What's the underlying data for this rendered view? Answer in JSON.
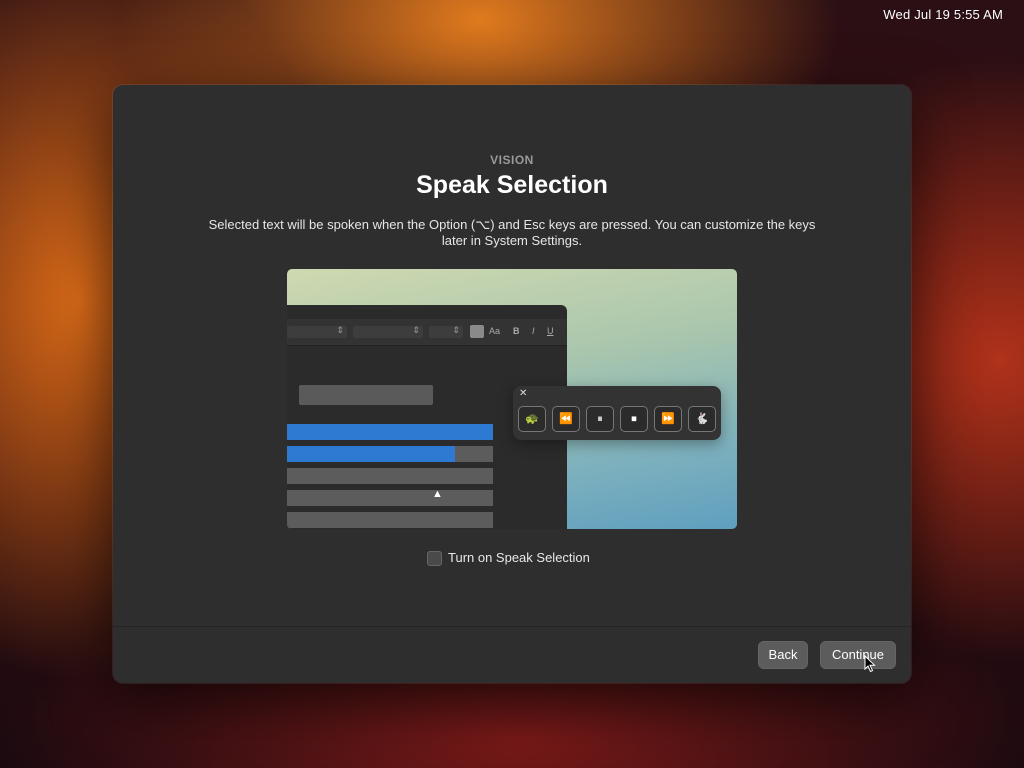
{
  "menubar": {
    "clock": "Wed Jul 19  5:55 AM"
  },
  "dialog": {
    "eyebrow": "VISION",
    "title": "Speak Selection",
    "description": "Selected text will be spoken when the Option (⌥) and Esc keys are pressed. You can customize the keys later in System Settings.",
    "checkbox": {
      "label": "Turn on Speak Selection",
      "checked": false
    },
    "buttons": {
      "back": "Back",
      "continue": "Continue"
    }
  },
  "illustration": {
    "toolbar": {
      "font_size_label": "Aa",
      "bold": "B",
      "italic": "I",
      "underline": "U"
    },
    "player": {
      "close": "✕",
      "buttons": [
        {
          "icon": "turtle-icon",
          "glyph": "🐢"
        },
        {
          "icon": "rewind-icon",
          "glyph": "⏪"
        },
        {
          "icon": "pause-icon",
          "glyph": "⏸"
        },
        {
          "icon": "stop-icon",
          "glyph": "⏹"
        },
        {
          "icon": "fast-forward-icon",
          "glyph": "⏩"
        },
        {
          "icon": "rabbit-icon",
          "glyph": "🐇"
        }
      ]
    }
  },
  "colors": {
    "selection": "#2e79d1",
    "window": "#2e2e2e",
    "button": "#5c5c5c"
  }
}
